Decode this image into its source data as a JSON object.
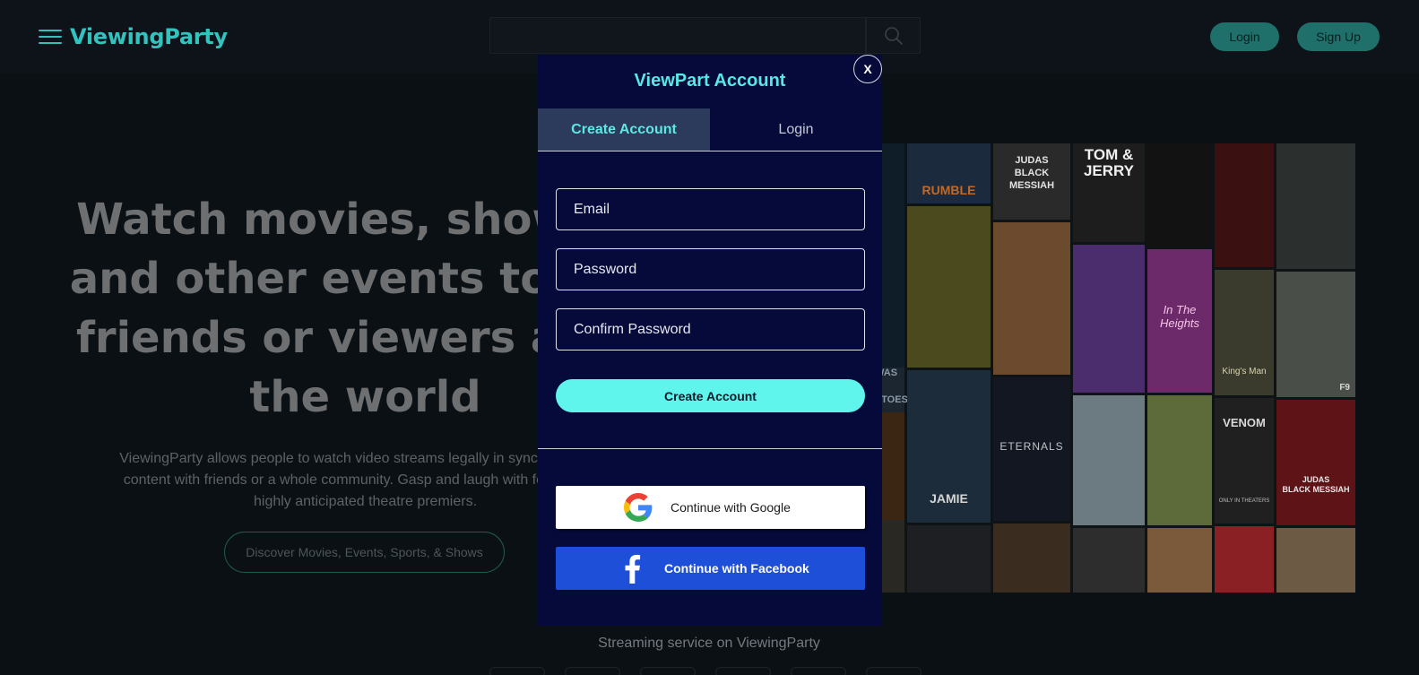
{
  "header": {
    "brand": "ViewingParty",
    "login_label": "Login",
    "signup_label": "Sign Up",
    "menu_icon": "hamburger-menu-icon",
    "search_icon": "search-icon"
  },
  "hero": {
    "title_lines": [
      "Watch movies, shows, s",
      "and other events togeth",
      "friends or viewers all ar",
      "the world"
    ],
    "description_lines": [
      "ViewingParty allows people to watch video streams legally in sync with others",
      "content with friends or a whole community. Gasp and laugh with fellow fans i",
      "highly anticipated theatre premiers."
    ],
    "discover_label": "Discover Movies, Events, Sports, & Shows"
  },
  "posters": {
    "texts": [
      "RUMBLE",
      "JUDAS",
      "BLACK MESSIAH",
      "TOM & JERRY",
      "In The Heights",
      "King's Man",
      "VENOM",
      "ETERNALS",
      "JAMIE",
      "WAS",
      "ATOES",
      "F9",
      "JUDAS",
      "BLACK MESSIAH",
      "ONLY IN THEATERS"
    ]
  },
  "footer": {
    "streaming_label": "Streaming service on ViewingParty"
  },
  "modal": {
    "title": "ViewPart Account",
    "close_label": "X",
    "tabs": [
      {
        "label": "Create Account",
        "active": true
      },
      {
        "label": "Login",
        "active": false
      }
    ],
    "fields": [
      {
        "placeholder": "Email"
      },
      {
        "placeholder": "Password"
      },
      {
        "placeholder": "Confirm Password"
      }
    ],
    "submit_label": "Create Account",
    "google_label": "Continue with Google",
    "facebook_label": "Continue with Facebook",
    "google_icon": "google-g-icon",
    "facebook_icon": "facebook-f-icon"
  },
  "colors": {
    "brand": "#33c3bf",
    "modal_bg": "#050a3b",
    "accent": "#60f5ec",
    "facebook": "#1e4fd8"
  }
}
